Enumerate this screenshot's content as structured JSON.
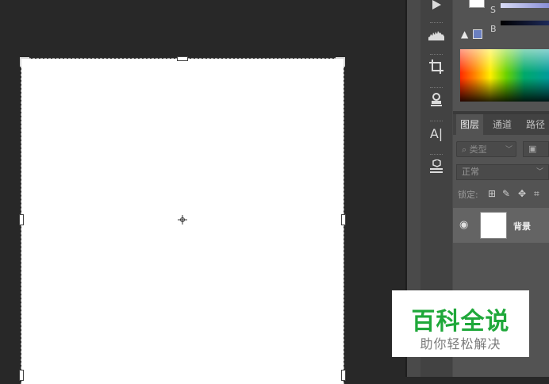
{
  "canvas": {
    "center_marker_icon": "crosshair-icon"
  },
  "toolbar": {
    "tools": [
      {
        "icon": "play-icon"
      },
      {
        "icon": "histogram-icon"
      },
      {
        "icon": "crop-icon"
      },
      {
        "icon": "stamp-icon"
      },
      {
        "icon": "character-icon",
        "text": "A|"
      },
      {
        "icon": "3d-cube-icon"
      }
    ]
  },
  "color_panel": {
    "s_label": "S",
    "b_label": "B",
    "slider_colors": {
      "s": "#8a8fd6",
      "b": "#1e2a5a"
    },
    "websafe_color": "#6a7fc0"
  },
  "layers_panel": {
    "tabs": [
      {
        "label": "图层",
        "active": true
      },
      {
        "label": "通道",
        "active": false
      },
      {
        "label": "路径",
        "active": false
      }
    ],
    "filter_placeholder": "类型",
    "blend_mode": "正常",
    "lock_label": "锁定:",
    "layers": [
      {
        "name": "背景",
        "visible": true
      }
    ]
  },
  "watermark": {
    "title": "百科全说",
    "subtitle": "助你轻松解决",
    "title_color": "#1fa83a"
  }
}
